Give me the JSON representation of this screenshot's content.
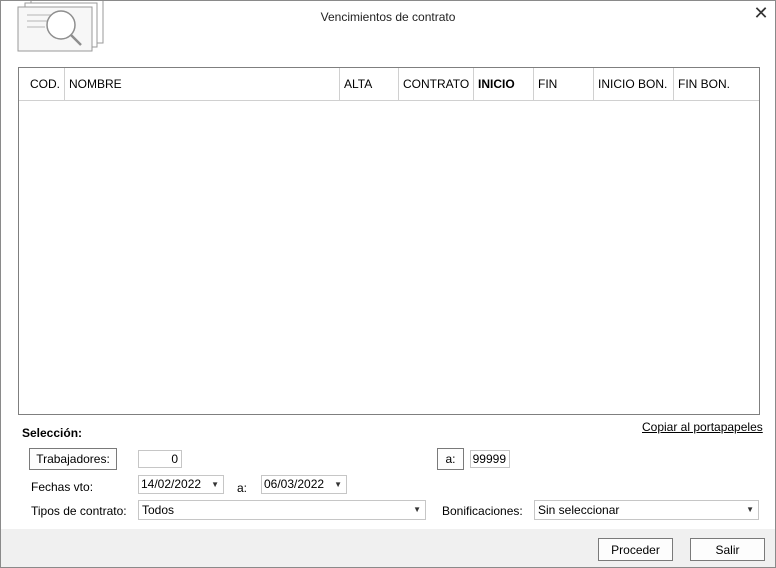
{
  "window": {
    "title": "Vencimientos de contrato",
    "close_glyph": "✕"
  },
  "grid": {
    "columns": [
      {
        "label": "COD.",
        "bold": false
      },
      {
        "label": "NOMBRE",
        "bold": false
      },
      {
        "label": "ALTA",
        "bold": false
      },
      {
        "label": "CONTRATO",
        "bold": false
      },
      {
        "label": "INICIO",
        "bold": true
      },
      {
        "label": "FIN",
        "bold": false
      },
      {
        "label": "INICIO BON.",
        "bold": false
      },
      {
        "label": "FIN BON.",
        "bold": false
      }
    ],
    "rows": []
  },
  "selection": {
    "label": "Selección:",
    "copy_link": "Copiar al portapapeles",
    "workers_button": "Trabajadores:",
    "workers_from": "0",
    "workers_to_button": "a:",
    "workers_to": "99999",
    "dates_label": "Fechas vto:",
    "date_from": "14/02/2022",
    "date_to_label": "a:",
    "date_to": "06/03/2022",
    "contract_types_label": "Tipos de contrato:",
    "contract_types_value": "Todos",
    "bonus_label": "Bonificaciones:",
    "bonus_value": "Sin seleccionar"
  },
  "footer": {
    "proceed": "Proceder",
    "exit": "Salir"
  },
  "icons": {
    "logo": "search-documents-icon",
    "dropdown": "chevron-down-icon"
  }
}
